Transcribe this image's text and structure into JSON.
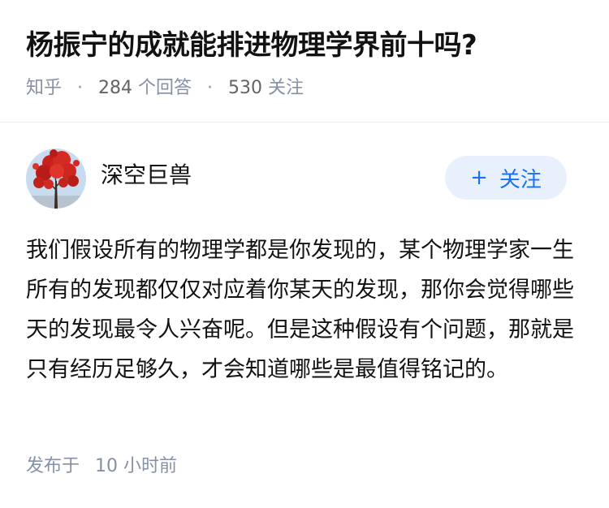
{
  "question": {
    "title": "杨振宁的成就能排进物理学界前十吗?",
    "source": "知乎",
    "answer_count": "284",
    "answer_label": "个回答",
    "follower_count": "530",
    "follower_label": "关注"
  },
  "author": {
    "name": "深空巨兽",
    "follow_button": {
      "icon": "+",
      "label": "关注"
    }
  },
  "answer": {
    "text": "我们假设所有的物理学都是你发现的，某个物理学家一生所有的发现都仅仅对应着你某天的发现，那你会觉得哪些天的发现最令人兴奋呢。但是这种假设有个问题，那就是只有经历足够久，才会知道哪些是最值得铭记的。",
    "published_prefix": "发布于",
    "published_time": "10 小时前"
  },
  "colors": {
    "accent": "#1772f6",
    "button_bg": "#e8f1fb",
    "meta_gray": "#8590a6",
    "text": "#121212"
  },
  "icons": {
    "avatar": "red-tree-avatar",
    "follow": "plus-icon"
  }
}
